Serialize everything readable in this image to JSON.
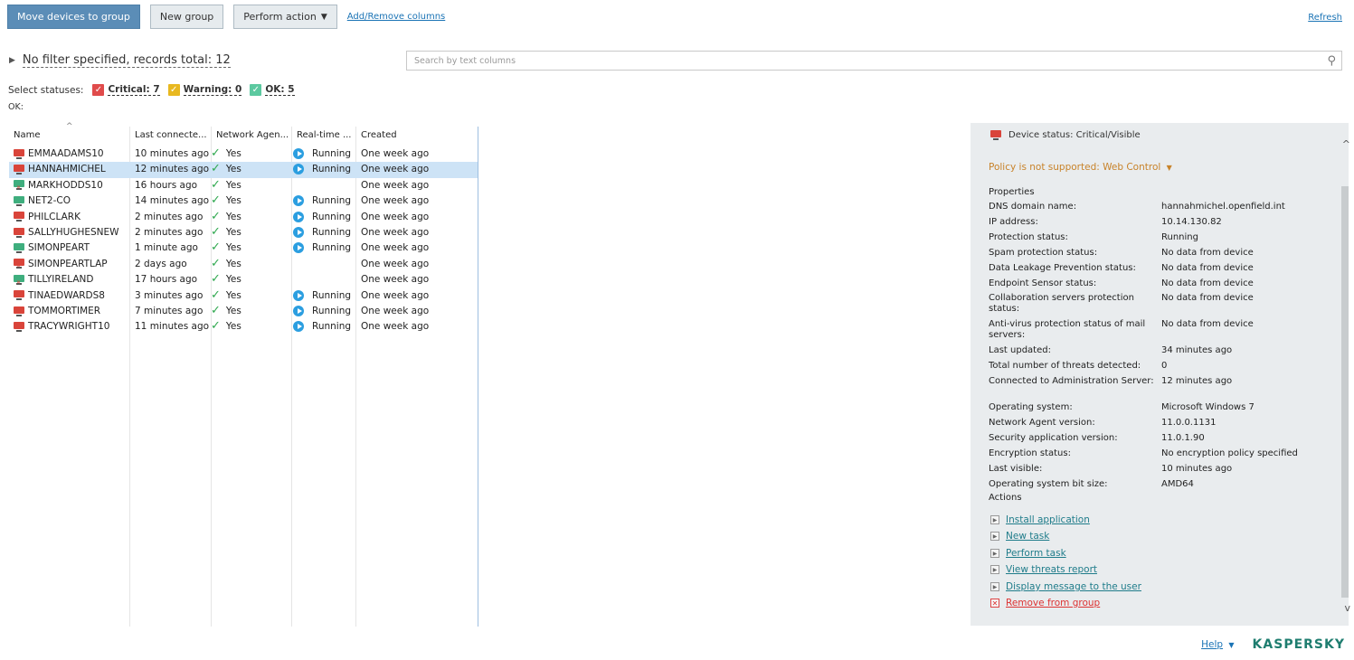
{
  "toolbar": {
    "move_label": "Move devices to group",
    "new_group_label": "New group",
    "perform_action_label": "Perform action",
    "add_remove_label": "Add/Remove columns",
    "refresh_label": "Refresh"
  },
  "filter": {
    "text": "No filter specified, records total: 12",
    "search_placeholder": "Search by text columns"
  },
  "statuses": {
    "label": "Select statuses:",
    "critical": "Critical: 7",
    "warning": "Warning: 0",
    "ok": "OK: 5",
    "ok_line": "OK:"
  },
  "table": {
    "columns": [
      "Name",
      "Last connecte...",
      "Network Agen...",
      "Real-time ...",
      "Created"
    ],
    "rows": [
      {
        "name": "EMMAADAMS10",
        "last": "10 minutes ago",
        "agent": "Yes",
        "rt": "Running",
        "created": "One week ago",
        "status": "critical"
      },
      {
        "name": "HANNAHMICHEL",
        "last": "12 minutes ago",
        "agent": "Yes",
        "rt": "Running",
        "created": "One week ago",
        "status": "critical"
      },
      {
        "name": "MARKHODDS10",
        "last": "16 hours ago",
        "agent": "Yes",
        "rt": "",
        "created": "One week ago",
        "status": "ok-x"
      },
      {
        "name": "NET2-CO",
        "last": "14 minutes ago",
        "agent": "Yes",
        "rt": "Running",
        "created": "One week ago",
        "status": "ok"
      },
      {
        "name": "PHILCLARK",
        "last": "2 minutes ago",
        "agent": "Yes",
        "rt": "Running",
        "created": "One week ago",
        "status": "critical"
      },
      {
        "name": "SALLYHUGHESNEW",
        "last": "2 minutes ago",
        "agent": "Yes",
        "rt": "Running",
        "created": "One week ago",
        "status": "critical"
      },
      {
        "name": "SIMONPEART",
        "last": "1 minute ago",
        "agent": "Yes",
        "rt": "Running",
        "created": "One week ago",
        "status": "ok"
      },
      {
        "name": "SIMONPEARTLAP",
        "last": "2 days ago",
        "agent": "Yes",
        "rt": "",
        "created": "One week ago",
        "status": "critical-x"
      },
      {
        "name": "TILLYIRELAND",
        "last": "17 hours ago",
        "agent": "Yes",
        "rt": "",
        "created": "One week ago",
        "status": "ok-x"
      },
      {
        "name": "TINAEDWARDS8",
        "last": "3 minutes ago",
        "agent": "Yes",
        "rt": "Running",
        "created": "One week ago",
        "status": "critical"
      },
      {
        "name": "TOMMORTIMER",
        "last": "7 minutes ago",
        "agent": "Yes",
        "rt": "Running",
        "created": "One week ago",
        "status": "critical"
      },
      {
        "name": "TRACYWRIGHT10",
        "last": "11 minutes ago",
        "agent": "Yes",
        "rt": "Running",
        "created": "One week ago",
        "status": "critical"
      }
    ],
    "selected_index": 1
  },
  "details": {
    "device_status": "Device status: Critical/Visible",
    "policy": "Policy is not supported: Web Control",
    "properties_heading": "Properties",
    "properties": [
      {
        "k": "DNS domain name:",
        "v": "hannahmichel.openfield.int"
      },
      {
        "k": "IP address:",
        "v": "10.14.130.82"
      },
      {
        "k": "Protection status:",
        "v": "Running"
      },
      {
        "k": "Spam protection status:",
        "v": "No data from device"
      },
      {
        "k": "Data Leakage Prevention status:",
        "v": "No data from device"
      },
      {
        "k": "Endpoint Sensor status:",
        "v": "No data from device"
      },
      {
        "k": "Collaboration servers protection status:",
        "v": "No data from device"
      },
      {
        "k": "Anti-virus protection status of mail servers:",
        "v": "No data from device"
      },
      {
        "k": "Last updated:",
        "v": "34 minutes ago"
      },
      {
        "k": "Total number of threats detected:",
        "v": "0"
      },
      {
        "k": "Connected to Administration Server:",
        "v": "12 minutes ago"
      },
      {
        "k": "Operating system:",
        "v": "Microsoft Windows 7"
      },
      {
        "k": "Network Agent version:",
        "v": "11.0.0.1131"
      },
      {
        "k": "Security application version:",
        "v": "11.0.1.90"
      },
      {
        "k": "Encryption status:",
        "v": "No encryption policy specified"
      },
      {
        "k": "Last visible:",
        "v": "10 minutes ago"
      },
      {
        "k": "Operating system bit size:",
        "v": "AMD64"
      }
    ],
    "actions_heading": "Actions",
    "actions": [
      "Install application",
      "New task",
      "Perform task",
      "View threats report",
      "Display message to the user",
      "Remove from group"
    ]
  },
  "footer": {
    "help_label": "Help",
    "logo_text": "KASPERSKY"
  },
  "colors": {
    "primary_button": "#5b8db7",
    "critical": "#d9443a",
    "ok": "#3fae7e",
    "policy_warning": "#c8832a",
    "selection": "#cde3f6"
  }
}
